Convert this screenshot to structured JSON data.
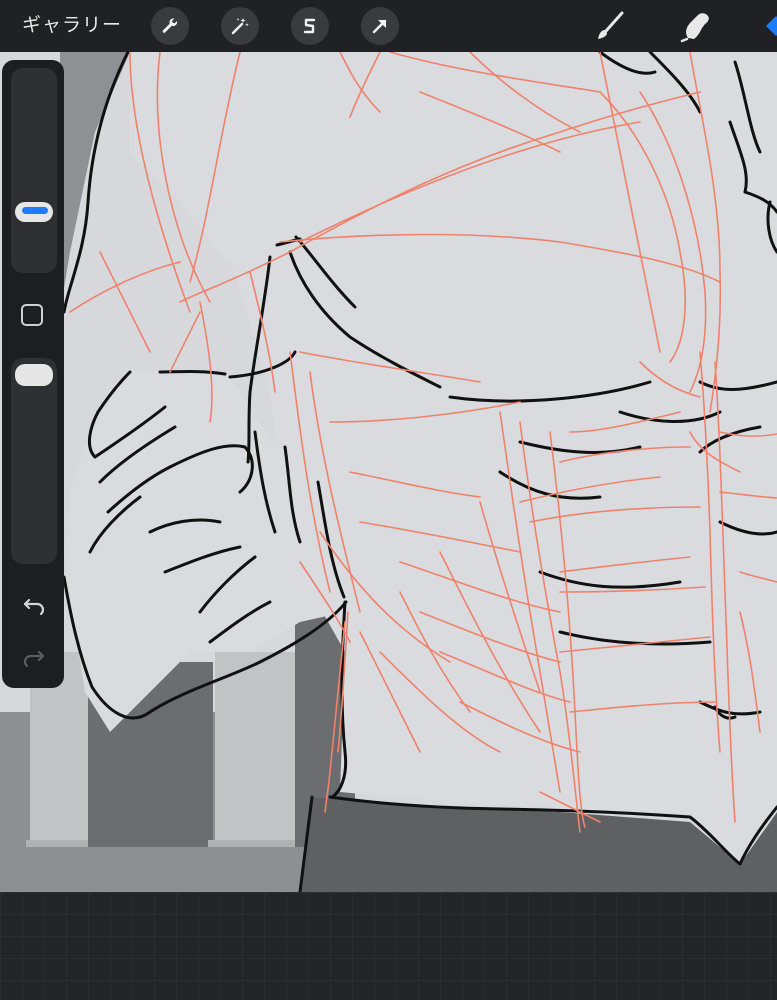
{
  "topbar": {
    "gallery_label": "ギャラリー",
    "tools": [
      "wrench-icon",
      "magic-wand-icon",
      "selection-s-icon",
      "transform-arrow-icon"
    ],
    "right_tools": [
      "brush-icon",
      "smudge-icon",
      "eraser-icon"
    ],
    "accent_color": "#1d7bff"
  },
  "sidebar": {
    "brush_size_slider": "brush-size",
    "opacity_slider": "brush-opacity"
  }
}
